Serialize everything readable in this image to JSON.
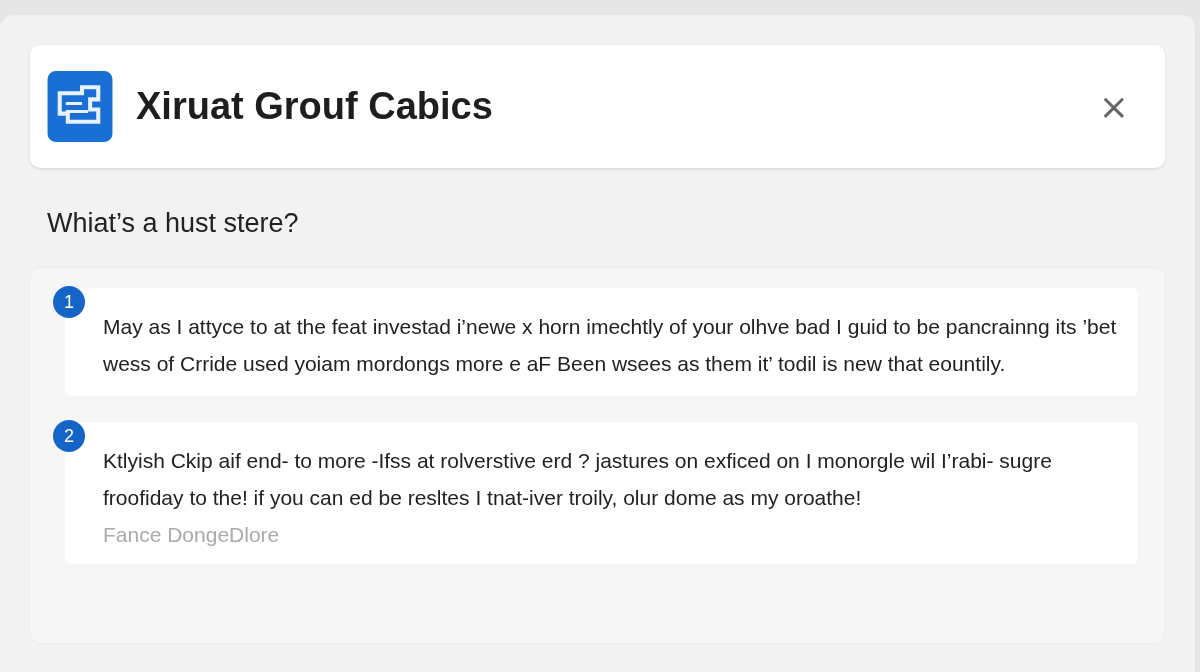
{
  "header": {
    "title": "Xiruat Grouf Cabics",
    "close": "×"
  },
  "question": "Whiat’s a hust stere?",
  "answers": [
    {
      "number": "1",
      "text": "May as I attyce to at the feat investad i’newe x horn imechtly of your olhve bad I guid to be pancrainng its ’bet wess of Crride used yoiam mordongs more e aF Been wsees as them it’ todil is new that eountily."
    },
    {
      "number": "2",
      "text": "Ktlyish Ckip aif end- to more -Ifss at rolverstive erd ? jastures on exficed on I monorgle wil I’rabi- sugre froofiday to the! if you can ed be resltes I tnat-iver troily, olur dome as my oroathe!",
      "note": "Fance DongeDlore"
    }
  ]
}
